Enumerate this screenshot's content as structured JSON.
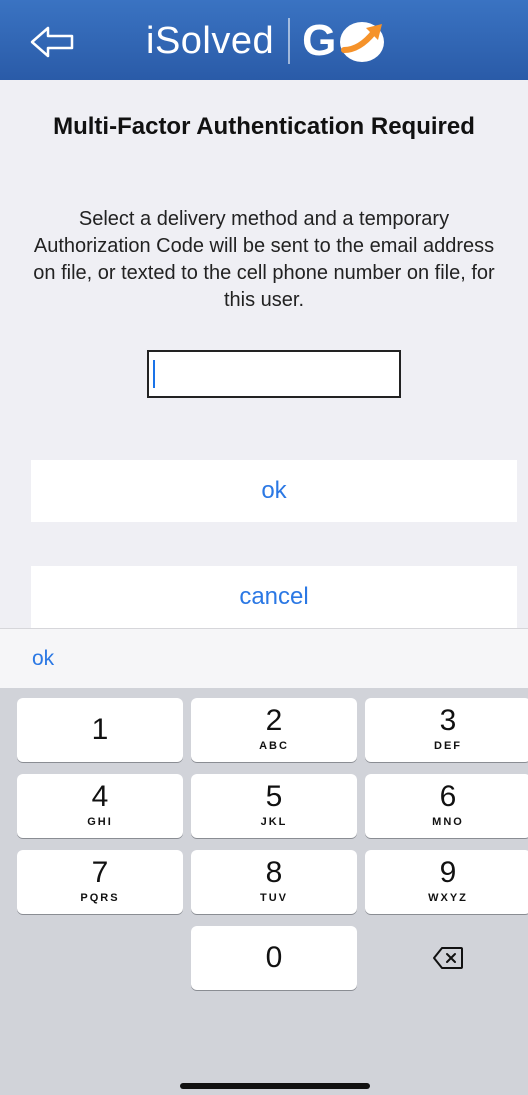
{
  "header": {
    "back_icon": "back-arrow-icon",
    "brand_name": "iSolved",
    "go_logo": "G",
    "colors": {
      "bar": "#2f64b0",
      "logo_accent": "#f5922a"
    }
  },
  "content": {
    "title": "Multi-Factor Authentication Required",
    "description": "Select a delivery method and a temporary Authorization Code will be sent to the email address on file, or texted to the cell phone number on file, for this user.",
    "code_input": {
      "value": "",
      "placeholder": ""
    },
    "ok_label": "ok",
    "cancel_label": "cancel"
  },
  "accessory_bar": {
    "ok_label": "ok"
  },
  "keyboard": {
    "keys": [
      {
        "digit": "1",
        "letters": ""
      },
      {
        "digit": "2",
        "letters": "ABC"
      },
      {
        "digit": "3",
        "letters": "DEF"
      },
      {
        "digit": "4",
        "letters": "GHI"
      },
      {
        "digit": "5",
        "letters": "JKL"
      },
      {
        "digit": "6",
        "letters": "MNO"
      },
      {
        "digit": "7",
        "letters": "PQRS"
      },
      {
        "digit": "8",
        "letters": "TUV"
      },
      {
        "digit": "9",
        "letters": "WXYZ"
      },
      {
        "digit": "0",
        "letters": ""
      }
    ],
    "delete_icon": "backspace-icon"
  },
  "theme": {
    "link_color": "#2b78e4",
    "background": "#efeff4",
    "keyboard_bg": "#d1d3d9"
  }
}
